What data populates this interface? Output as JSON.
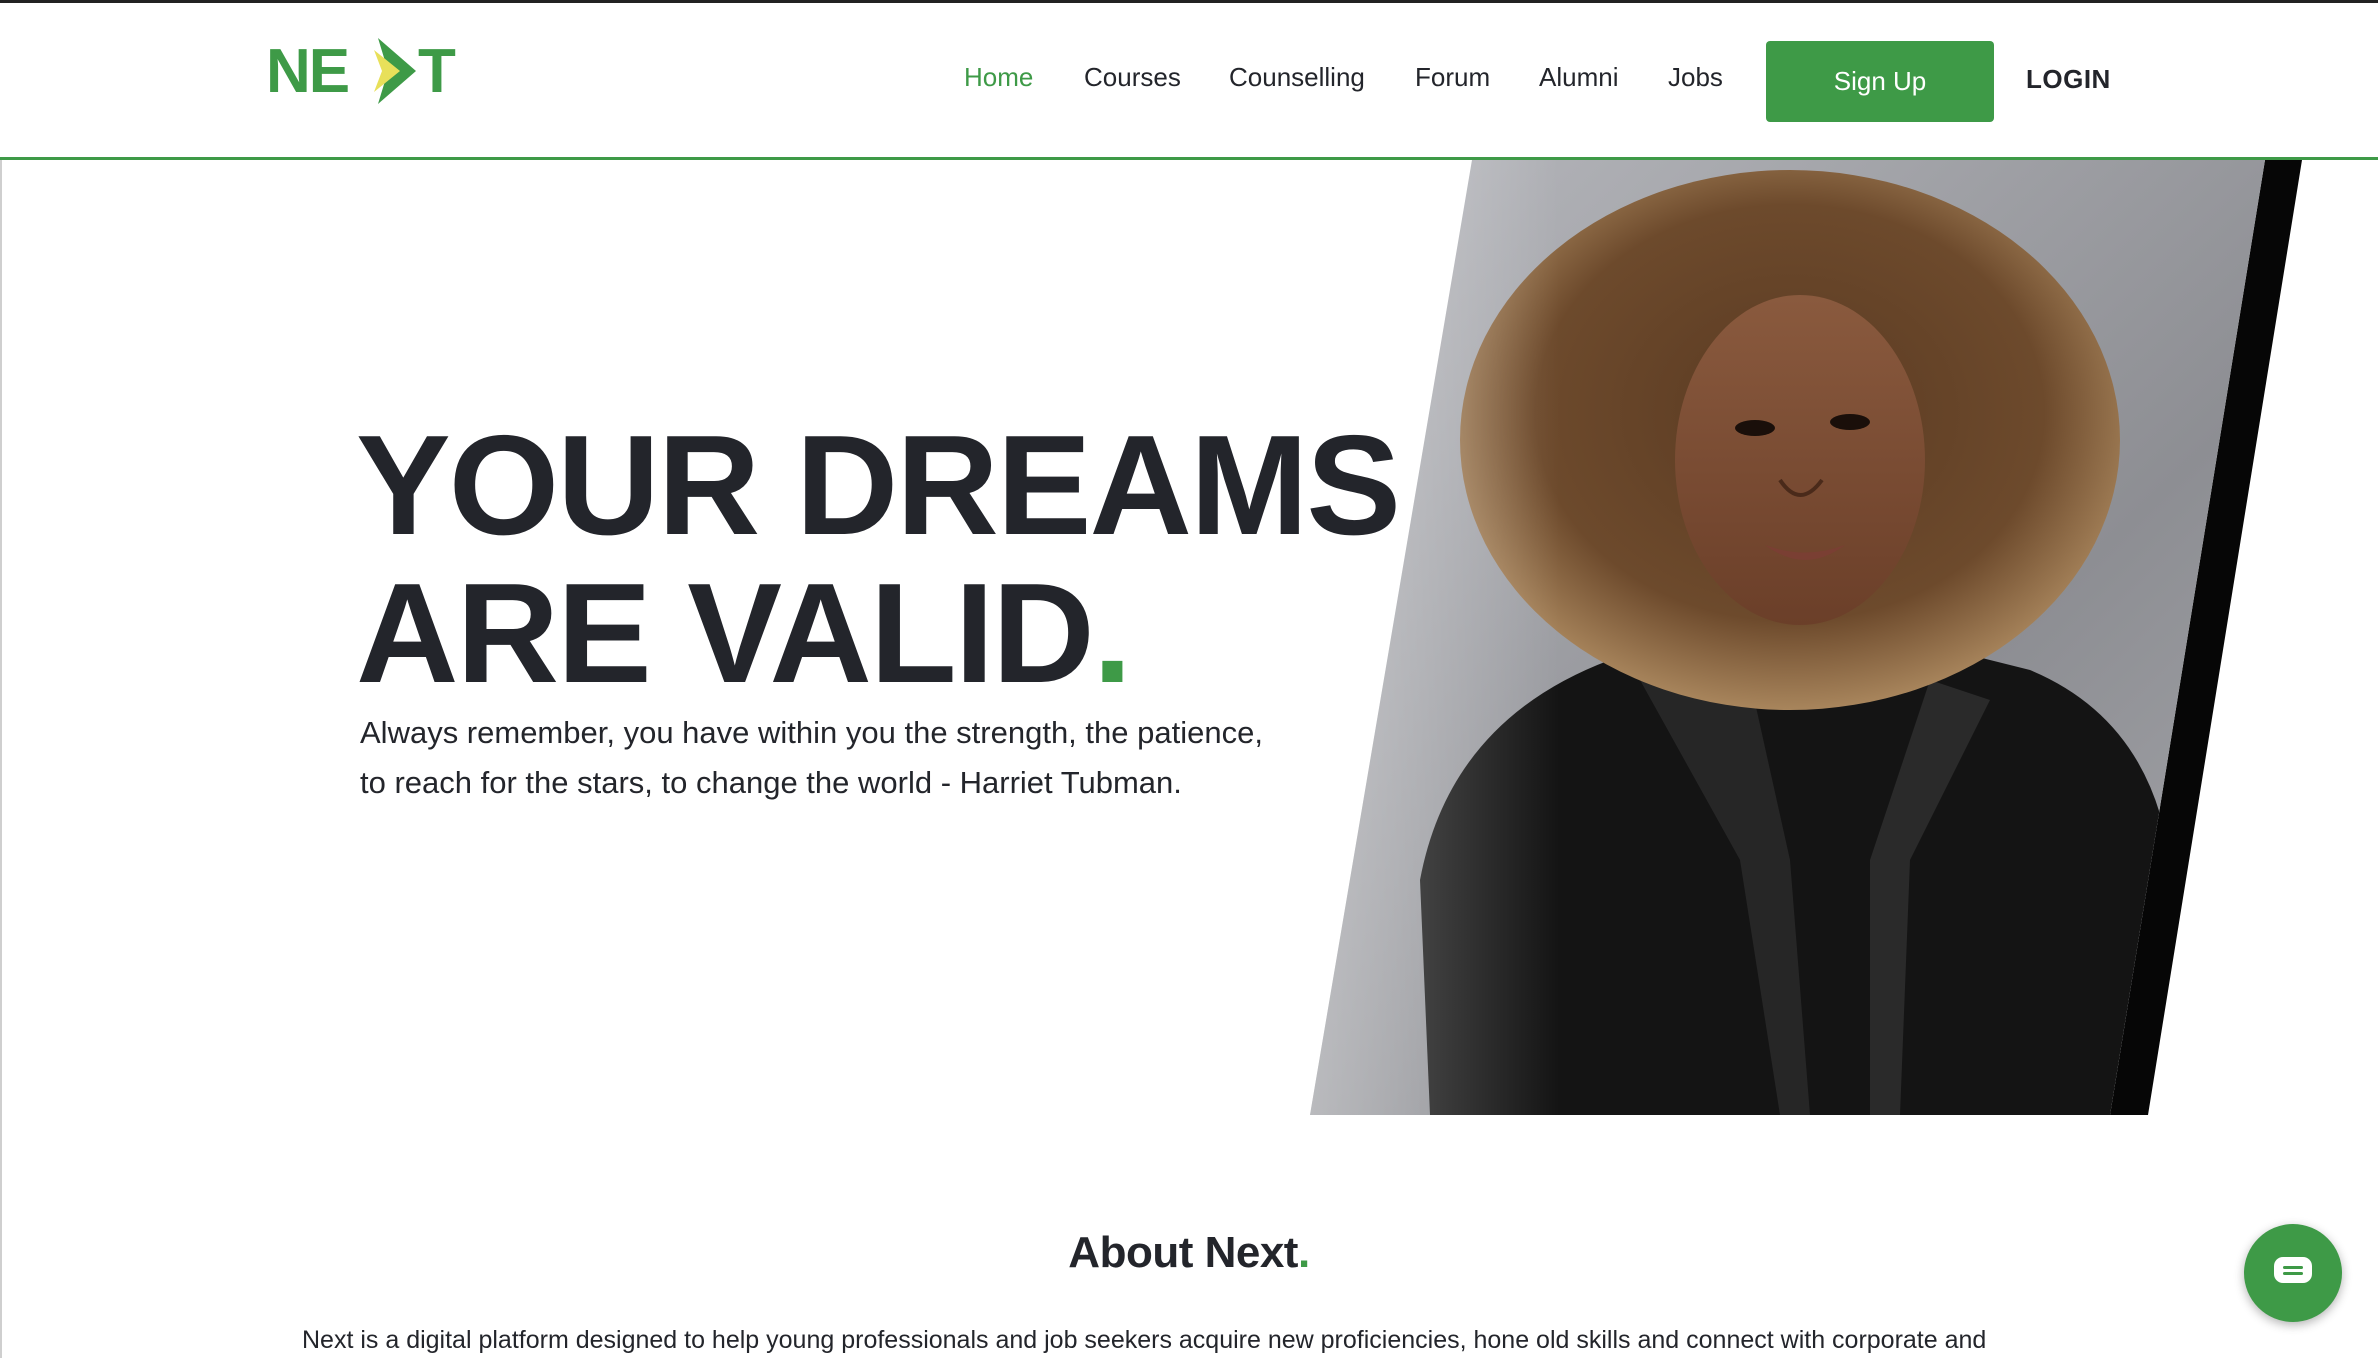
{
  "brand": {
    "logo_text": "NEXT",
    "accent_color": "#3e9a47",
    "logo_secondary_color": "#e8e05a"
  },
  "nav": {
    "items": [
      {
        "label": "Home",
        "active": true
      },
      {
        "label": "Courses",
        "active": false
      },
      {
        "label": "Counselling",
        "active": false
      },
      {
        "label": "Forum",
        "active": false
      },
      {
        "label": "Alumni",
        "active": false
      },
      {
        "label": "Jobs",
        "active": false
      }
    ],
    "signup_label": "Sign Up",
    "login_label": "LOGIN"
  },
  "hero": {
    "title_line1": "YOUR DREAMS",
    "title_line2": "ARE VALID",
    "title_dot": ".",
    "quote_line1": "Always remember, you have within you the strength, the patience,",
    "quote_line2": "to reach for the stars, to change the world - Harriet Tubman."
  },
  "about": {
    "title": "About Next",
    "title_dot": ".",
    "text": "Next is a digital platform designed to help young professionals and job seekers acquire new proficiencies, hone old skills and connect with corporate and"
  },
  "icons": {
    "chat": "chat-bubble-icon"
  }
}
